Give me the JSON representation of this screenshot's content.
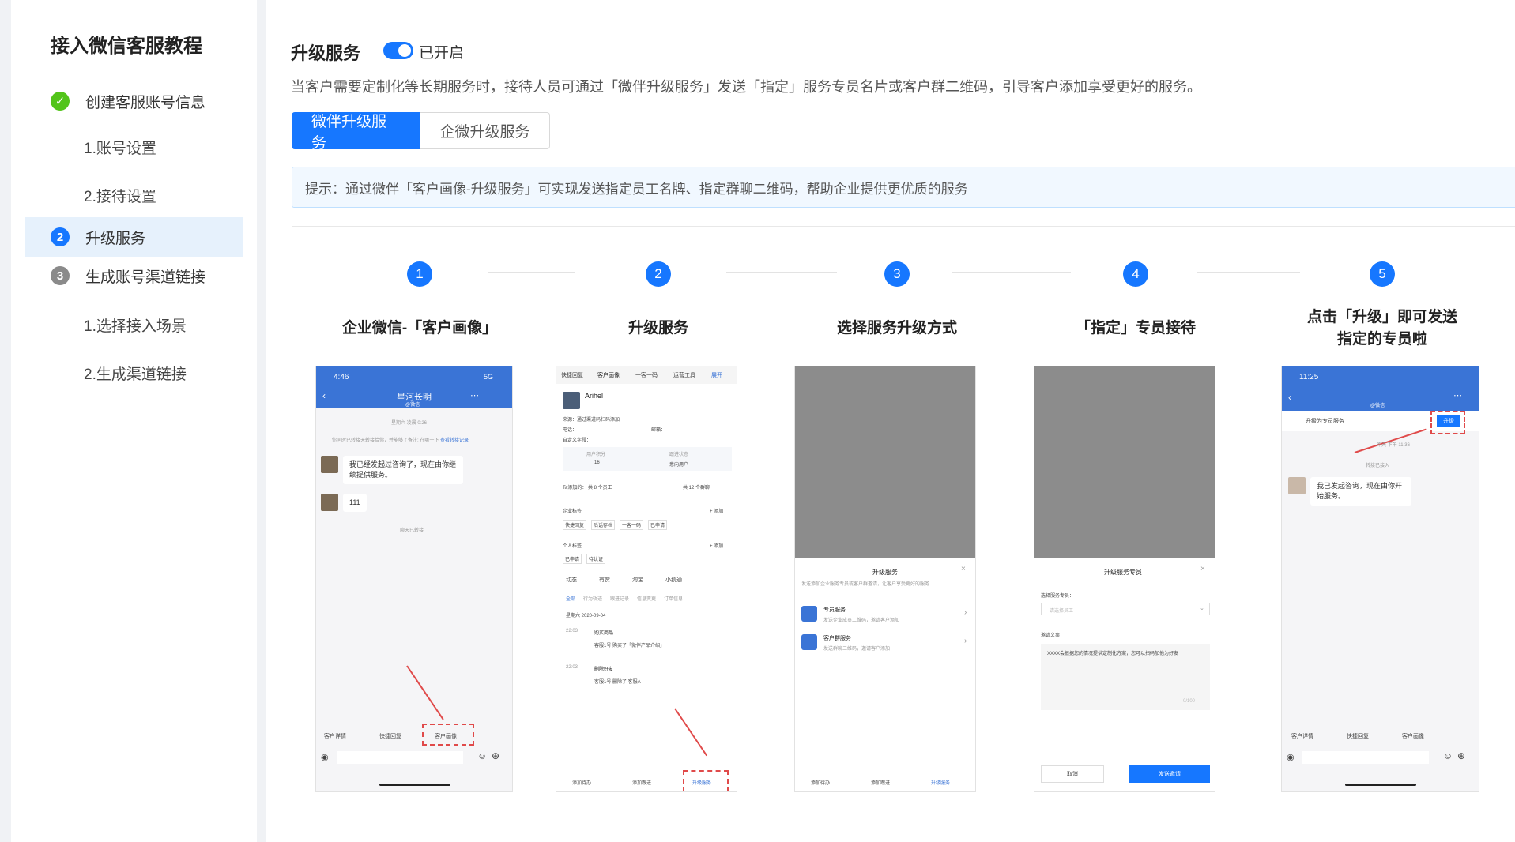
{
  "sidebar": {
    "title": "接入微信客服教程",
    "steps": [
      {
        "badge": "✓",
        "label": "创建客服账号信息",
        "state": "done"
      },
      {
        "badge": "2",
        "label": "升级服务",
        "state": "active"
      },
      {
        "badge": "3",
        "label": "生成账号渠道链接",
        "state": "pending"
      }
    ],
    "subs": [
      "1.账号设置",
      "2.接待设置",
      "1.选择接入场景",
      "2.生成渠道链接"
    ]
  },
  "main": {
    "title": "升级服务",
    "toggle_label": "已开启",
    "description": "当客户需要定制化等长期服务时，接待人员可通过「微伴升级服务」发送「指定」服务专员名片或客户群二维码，引导客户添加享受更好的服务。",
    "tabs": [
      {
        "label": "微伴升级服务"
      },
      {
        "label": "企微升级服务"
      }
    ],
    "tip": "提示：通过微伴「客户画像-升级服务」可实现发送指定员工名牌、指定群聊二维码，帮助企业提供更优质的服务",
    "flow": [
      {
        "num": "1",
        "caption": "企业微信-「客户画像」"
      },
      {
        "num": "2",
        "caption": "升级服务"
      },
      {
        "num": "3",
        "caption": "选择服务升级方式"
      },
      {
        "num": "4",
        "caption": "「指定」专员接待"
      },
      {
        "num": "5",
        "caption": "点击「升级」即可发送指定的专员啦"
      }
    ]
  },
  "phone1": {
    "time": "4:46",
    "signal": "5G",
    "title": "星河长明",
    "subtitle": "@微信",
    "date": "星期六 凌晨 0:26",
    "notice": "你同时已转接天转接给你，并能够了备注; 在哪一下",
    "notice_link": "查看转接记录",
    "msg1": "我已经发起过咨询了，现在由你继续提供服务。",
    "msg2": "111",
    "closed": "聊天已转接",
    "bottom": [
      "客户详情",
      "快捷回复",
      "客户画像"
    ]
  },
  "phone2": {
    "tabs": [
      "快捷回复",
      "客户画像",
      "一客一码",
      "运营工具",
      "展开"
    ],
    "name": "Arihel",
    "source": "来源：",
    "source_val": "通过渠道码扫码添加",
    "phone": "电话：",
    "email": "邮箱：",
    "custom": "自定义字段：",
    "score_label": "用户积分",
    "score": "16",
    "status_label": "跟进状态",
    "status": "意向用户",
    "added": "Ta添加的：",
    "members": "共 8 个员工",
    "groups": "共 12 个群聊",
    "corp_tag": "企业标签",
    "add": "+ 添加",
    "corp_tags": [
      "快捷回复",
      "后话存档",
      "一客一码",
      "已申请"
    ],
    "personal_tag": "个人标签",
    "personal_tags": [
      "已申请",
      "待认证"
    ],
    "feed_tabs": [
      "动态",
      "有赞",
      "淘宝",
      "小鹅通"
    ],
    "filters": [
      "全部",
      "行为轨迹",
      "跟进记录",
      "信息变更",
      "订单信息"
    ],
    "date": "星期六  2020-09-04",
    "event1": "购买商品",
    "event1_detail": "客服1号 购买了「微伴产品介绍」",
    "event1_time": "22:03",
    "event2": "删除好友",
    "event2_detail": "客服1号 删除了 客服A",
    "event2_time": "22:03",
    "bottom": [
      "添加待办",
      "添加跟进",
      "升级服务"
    ]
  },
  "phone3": {
    "sheet_title": "升级服务",
    "sheet_desc": "发送添加企业服务专员或客户群邀请，让客户享受更好的服务",
    "opt1": "专员服务",
    "opt1_desc": "发送企业成员二维码，邀请客户添加",
    "opt2": "客户群服务",
    "opt2_desc": "发送群聊二维码，邀请客户添加",
    "bottom": [
      "添加待办",
      "添加跟进",
      "升级服务"
    ]
  },
  "phone4": {
    "sheet_title": "升级服务专员",
    "select_label": "选择服务专员：",
    "select_placeholder": "请选择员工",
    "invite_label": "邀请文案",
    "invite_text": "XXXX会根据您的情况提供定制化方案，您可以扫码加他为好友",
    "counter": "0/100",
    "cancel": "取消",
    "send": "发送邀请"
  },
  "phone5": {
    "time": "11:25",
    "subtitle": "@微信",
    "banner": "升级为专员服务",
    "upgrade": "升级",
    "date": "昨天 下午 11:36",
    "joined": "转接已接入",
    "msg": "我已发起咨询，现在由你开始服务。",
    "bottom": [
      "客户详情",
      "快捷回复",
      "客户画像"
    ]
  }
}
